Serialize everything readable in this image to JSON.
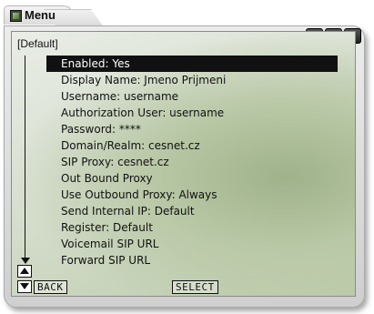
{
  "window": {
    "title": "Menu",
    "buttons": [
      "?",
      "–",
      "X"
    ]
  },
  "screen": {
    "profile": "[Default]",
    "items": [
      {
        "label": "Enabled: Yes",
        "selected": true
      },
      {
        "label": "Display Name: Jmeno Prijmeni"
      },
      {
        "label": "Username: username"
      },
      {
        "label": "Authorization User: username"
      },
      {
        "label": "Password: ****"
      },
      {
        "label": "Domain/Realm: cesnet.cz"
      },
      {
        "label": "SIP Proxy: cesnet.cz"
      },
      {
        "label": "Out Bound Proxy"
      },
      {
        "label": "Use Outbound Proxy: Always"
      },
      {
        "label": "Send Internal IP: Default"
      },
      {
        "label": "Register: Default"
      },
      {
        "label": "Voicemail SIP URL"
      },
      {
        "label": "Forward SIP URL"
      }
    ],
    "softkeys": {
      "back": "BACK",
      "select": "SELECT"
    }
  }
}
